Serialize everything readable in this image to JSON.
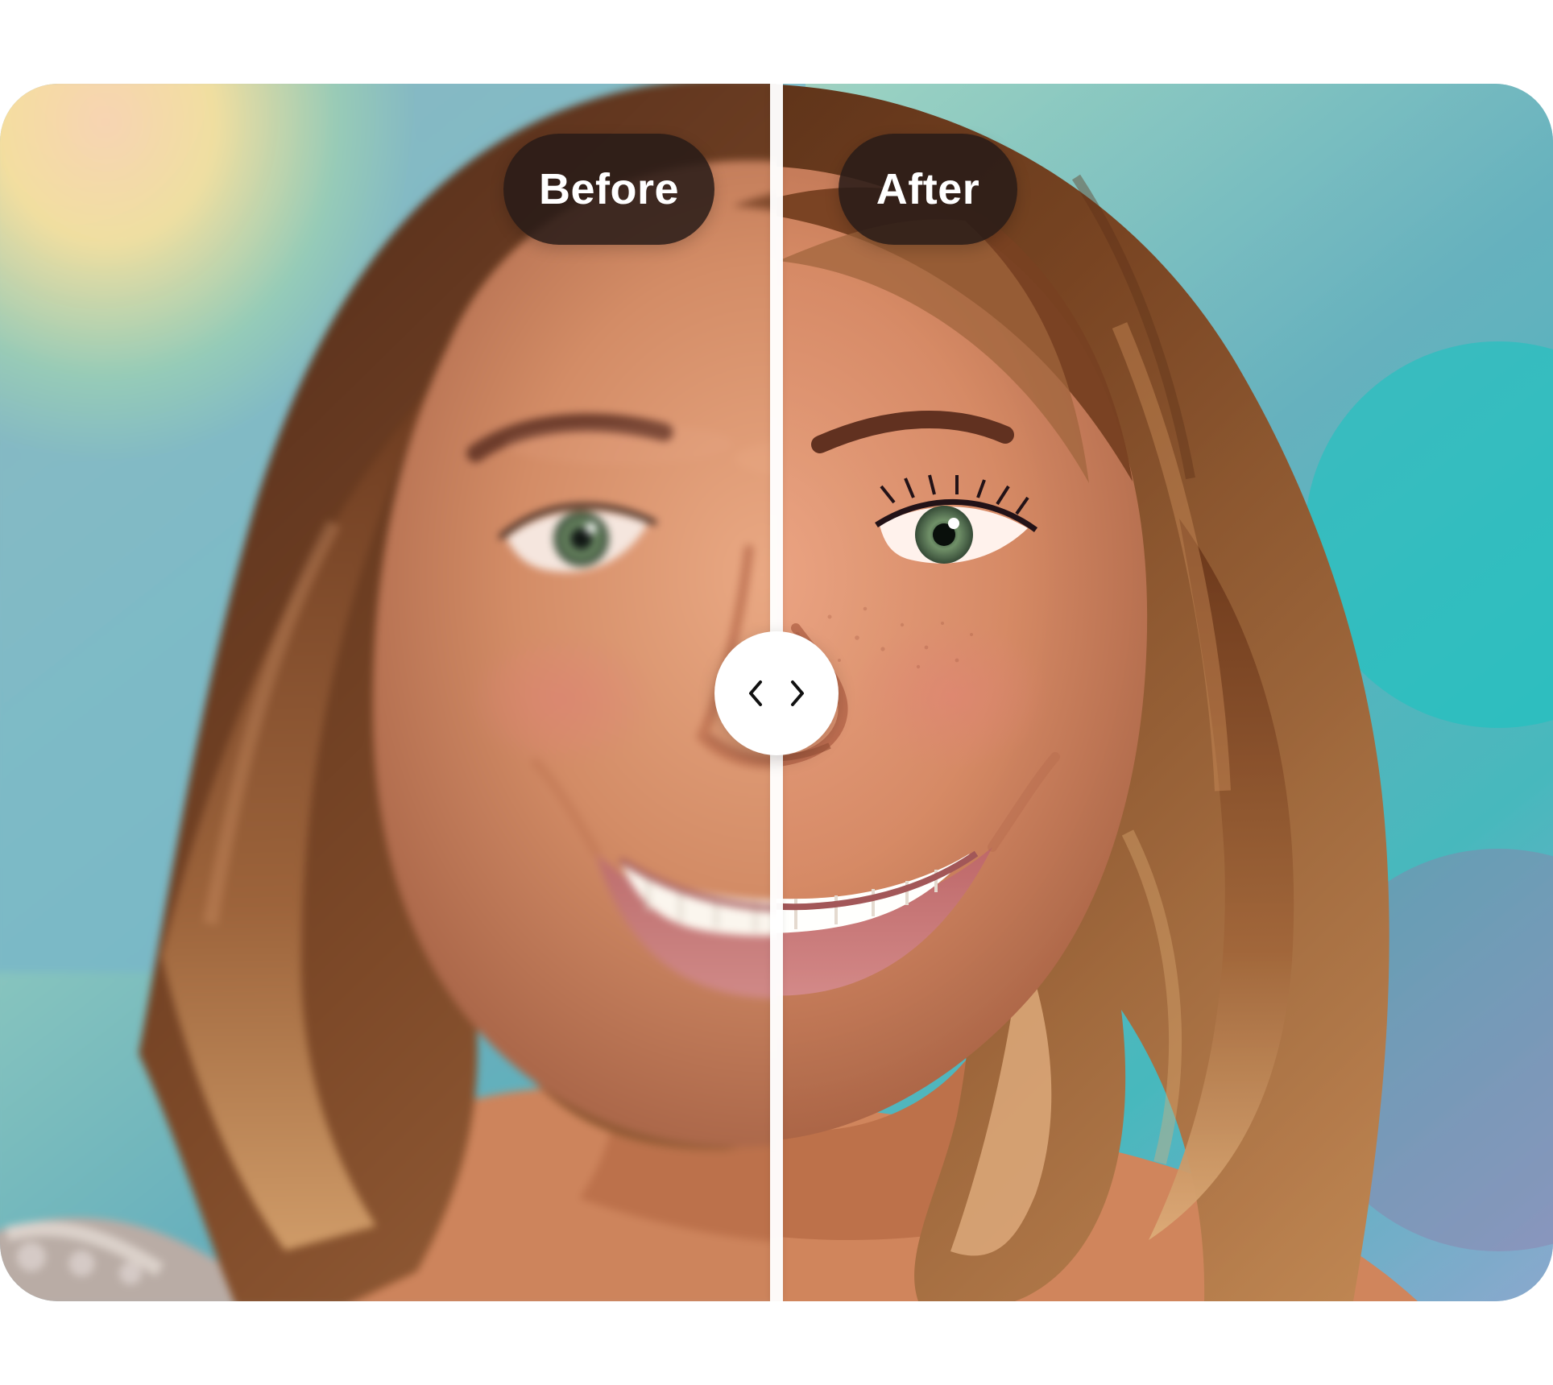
{
  "comparison": {
    "before_label": "Before",
    "after_label": "After",
    "split_percent": 50,
    "handle_icons": [
      "chevron-left-icon",
      "chevron-right-icon"
    ],
    "colors": {
      "pill_background": "#2a1c18",
      "pill_text": "#ffffff",
      "divider": "#ffffff",
      "handle": "#ffffff"
    }
  }
}
